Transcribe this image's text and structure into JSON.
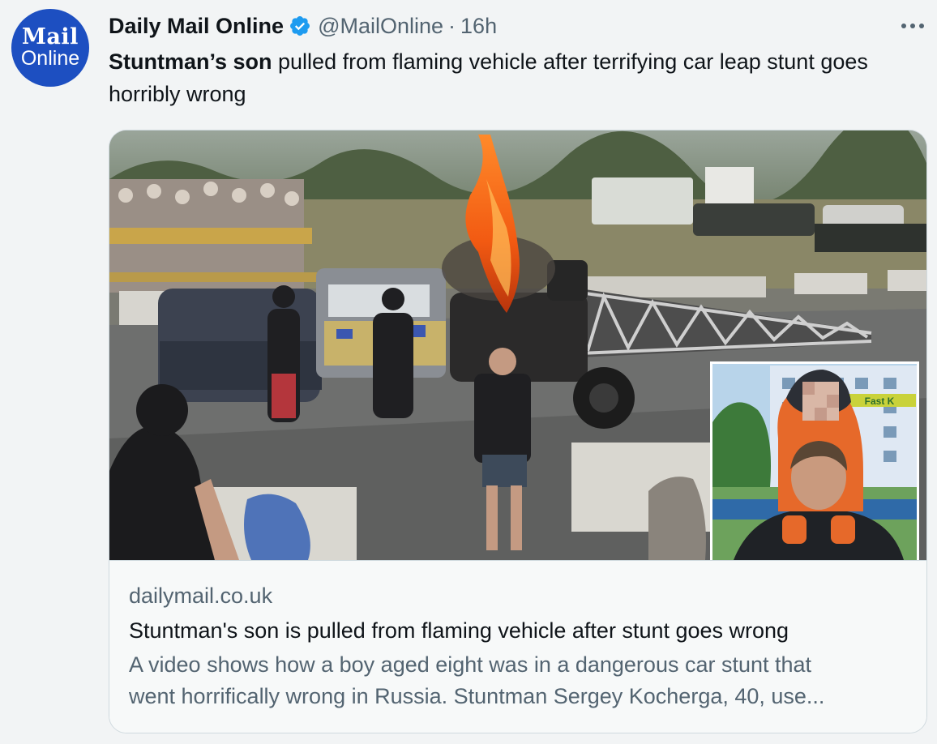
{
  "tweet": {
    "author": {
      "avatar_line1": "Mail",
      "avatar_line2": "Online",
      "display_name": "Daily Mail Online",
      "handle": "@MailOnline",
      "separator": "·",
      "time": "16h",
      "verified": true
    },
    "text_bold": "Stuntman’s son",
    "text_rest": " pulled from flaming vehicle after terrifying car leap stunt goes horribly wrong",
    "more_label": "•••"
  },
  "card": {
    "domain": "dailymail.co.uk",
    "title": "Stuntman's son is pulled from flaming vehicle after stunt goes wrong",
    "description_line1": "A video shows how a boy aged eight was in a dangerous car stunt that",
    "description_line2": "went horrifically wrong in Russia. Stuntman Sergey Kocherga, 40, use...",
    "inset_sign_text": "Fast K"
  },
  "colors": {
    "accent_verified": "#1d9bf0",
    "avatar_bg": "#1d4fc1",
    "text_primary": "#0f1419",
    "text_secondary": "#536471",
    "background": "#f2f4f5",
    "card_border": "#cfd9de"
  },
  "icons": {
    "verified": "verified-badge-icon",
    "more": "more-options-icon"
  }
}
